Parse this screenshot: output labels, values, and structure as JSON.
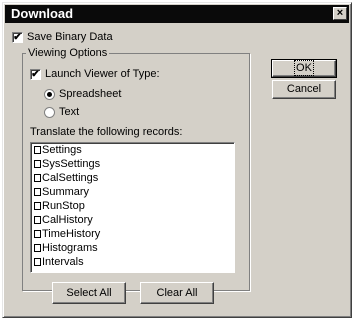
{
  "window": {
    "title": "Download",
    "close_glyph": "×"
  },
  "save_binary": {
    "label": "Save Binary Data",
    "checked": true
  },
  "viewing_options": {
    "group_label": "Viewing Options",
    "launch_viewer": {
      "label": "Launch Viewer of Type:",
      "checked": true
    },
    "radios": [
      {
        "label": "Spreadsheet",
        "selected": true
      },
      {
        "label": "Text",
        "selected": false
      }
    ],
    "translate_label": "Translate the following records:",
    "records": [
      "Settings",
      "SysSettings",
      "CalSettings",
      "Summary",
      "RunStop",
      "CalHistory",
      "TimeHistory",
      "Histograms",
      "Intervals"
    ],
    "select_all_label": "Select All",
    "clear_all_label": "Clear All"
  },
  "buttons": {
    "ok_label": "OK",
    "cancel_label": "Cancel"
  },
  "check_glyph": "✔"
}
